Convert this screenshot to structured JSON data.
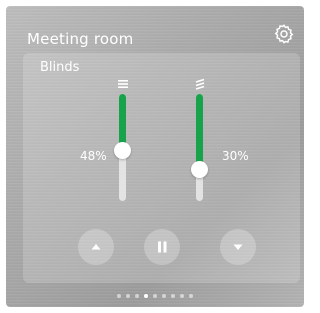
{
  "widget": {
    "title": "Meeting room",
    "settings_icon": "gear-icon"
  },
  "panel": {
    "title": "Blinds"
  },
  "sliders": [
    {
      "icon": "blind-height-icon",
      "value": 0.48,
      "label": "48%"
    },
    {
      "icon": "slat-angle-icon",
      "value": 0.3,
      "label": "30%"
    }
  ],
  "controls": [
    {
      "name": "up-button",
      "icon": "triangle-up-icon"
    },
    {
      "name": "pause-button",
      "icon": "pause-icon"
    },
    {
      "name": "down-button",
      "icon": "triangle-down-icon"
    }
  ],
  "pagination": {
    "count": 9,
    "active_index": 3
  },
  "colors": {
    "accent": "#16a34a"
  }
}
